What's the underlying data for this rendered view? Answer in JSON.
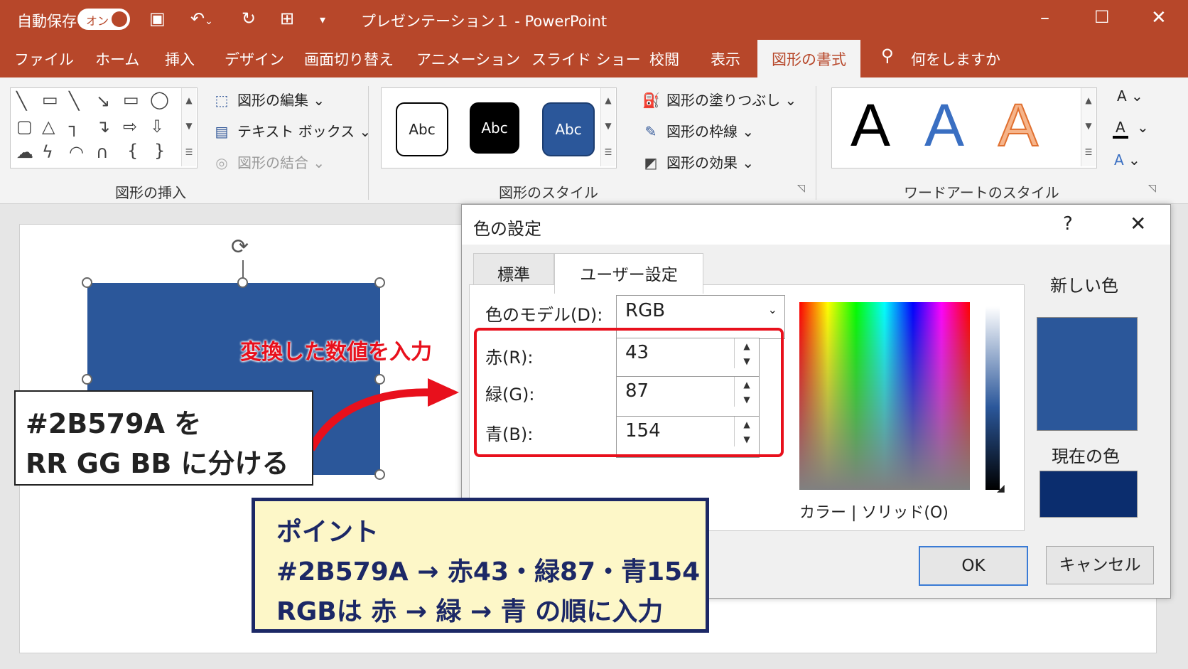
{
  "titlebar": {
    "autosave_label": "自動保存",
    "autosave_state": "オン",
    "doc_title": "プレゼンテーション１ - PowerPoint",
    "qa_save_icon": "save-icon",
    "qa_undo_icon": "undo-icon",
    "qa_redo_icon": "redo-icon",
    "qa_present_icon": "present-from-start-icon",
    "qa_more_icon": "customize-qat-icon",
    "minimize": "–",
    "maximize": "☐",
    "close": "✕",
    "bar_color": "#b7472a"
  },
  "menu": {
    "items": [
      "ファイル",
      "ホーム",
      "挿入",
      "デザイン",
      "画面切り替え",
      "アニメーション",
      "スライド ショー",
      "校閲",
      "表示",
      "図形の書式"
    ],
    "tellme": "何をしますか",
    "active": "図形の書式"
  },
  "ribbon": {
    "insert_shapes": {
      "label": "図形の挿入",
      "edit_shape": "図形の編集",
      "text_box": "テキスト ボックス",
      "merge_shapes": "図形の結合"
    },
    "shape_styles": {
      "label": "図形のスタイル",
      "swatches": [
        "Abc",
        "Abc",
        "Abc"
      ],
      "fill": "図形の塗りつぶし",
      "outline": "図形の枠線",
      "effects": "図形の効果"
    },
    "wordart": {
      "label": "ワードアートのスタイル",
      "samples": [
        "A",
        "A",
        "A"
      ],
      "side": [
        "A",
        "A",
        "A"
      ]
    }
  },
  "slide": {
    "shape_color": "#2b579a"
  },
  "dialog": {
    "title": "色の設定",
    "help": "?",
    "close": "✕",
    "tabs": [
      "標準",
      "ユーザー設定"
    ],
    "model_label": "色のモデル(D):",
    "model_value": "RGB",
    "red_label": "赤(R):",
    "red_value": "43",
    "green_label": "緑(G):",
    "green_value": "87",
    "blue_label": "青(B):",
    "blue_value": "154",
    "colortype_label": "カラー | ソリッド(O)",
    "new_color_label": "新しい色",
    "current_color_label": "現在の色",
    "new_color": "#2b579a",
    "current_color": "#0b2d6e",
    "ok": "OK",
    "cancel": "キャンセル"
  },
  "annotations": {
    "input_note": "変換した数値を入力",
    "split_line1": "#2B579A を",
    "split_line2": "RR GG BB に分ける",
    "point_title": "ポイント",
    "point_line1": "#2B579A → 赤43・緑87・青154",
    "point_line2": "RGBは 赤 → 緑 → 青 の順に入力",
    "highlight_color": "#e8101c"
  }
}
